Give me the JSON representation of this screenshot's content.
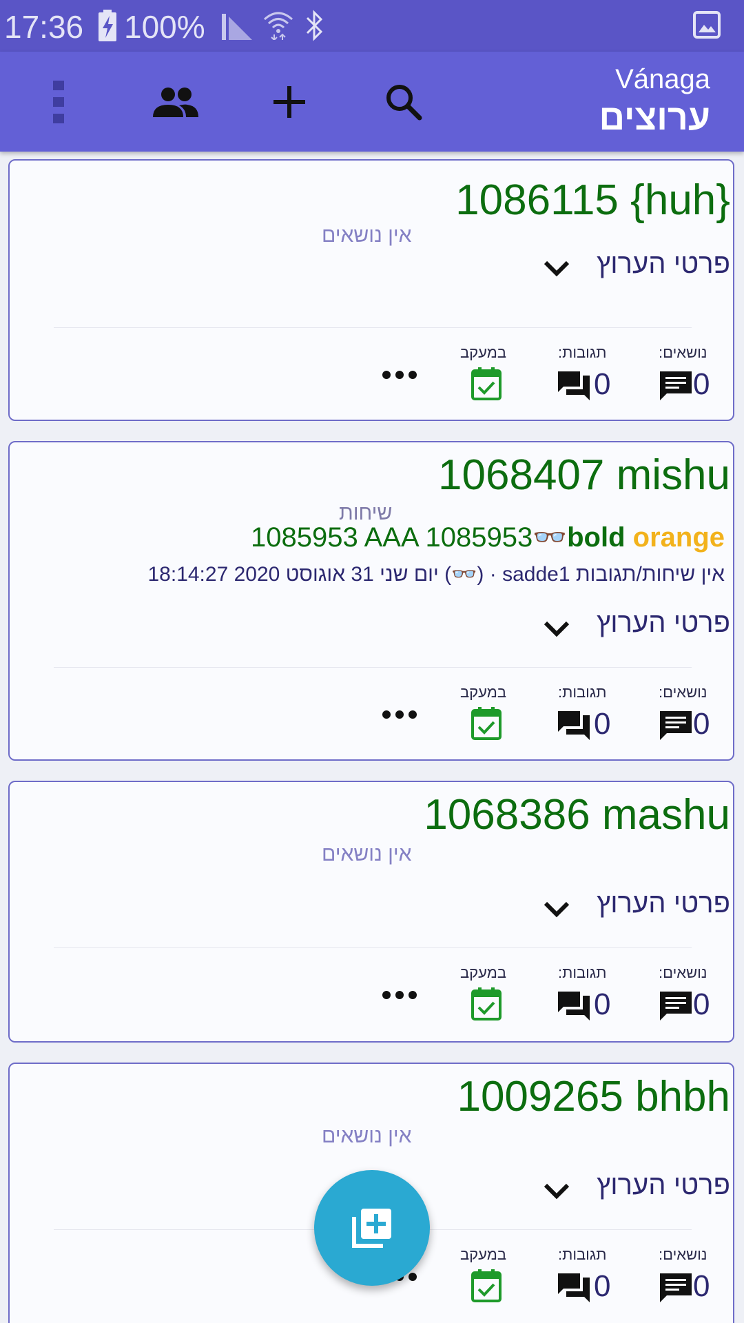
{
  "status_bar": {
    "time": "17:36",
    "battery": "100%",
    "icons": [
      "battery-charging-icon",
      "signal-icon",
      "wifi-icon",
      "bluetooth-icon",
      "image-icon"
    ]
  },
  "app_bar": {
    "subtitle": "Vánaga",
    "title": "ערוצים",
    "actions": [
      "more-vert-icon",
      "people-icon",
      "add-icon",
      "search-icon"
    ]
  },
  "labels": {
    "no_topics": "אין נושאים",
    "details": "פרטי הערוץ",
    "topics": "נושאים:",
    "replies": "תגובות:",
    "tracking": "במעקב"
  },
  "channels": [
    {
      "title": "1086115 {huh}",
      "topics_count": "0",
      "replies_count": "0"
    },
    {
      "title": "1068407 mishu",
      "topics_label": "שיחות",
      "topic_text": "1085953 AAA 1085953",
      "topic_glasses": "👓",
      "topic_bold": "bold",
      "topic_orange": "orange",
      "meta": "אין שיחות/תגובות sadde1 · (👓) יום שני 31 אוגוסט 2020 18:14:27",
      "topics_count": "0",
      "replies_count": "0"
    },
    {
      "title": "1068386 mashu",
      "topics_count": "0",
      "replies_count": "0"
    },
    {
      "title": "1009265 bhbh",
      "topics_count": "0",
      "replies_count": "0"
    }
  ],
  "colors": {
    "status_bar": "#5a55c6",
    "app_bar": "#6360d6",
    "title_green": "#0c6d0f",
    "accent_orange": "#f2b21c",
    "fab": "#2aa9d2",
    "track_green": "#1e9a2a"
  }
}
